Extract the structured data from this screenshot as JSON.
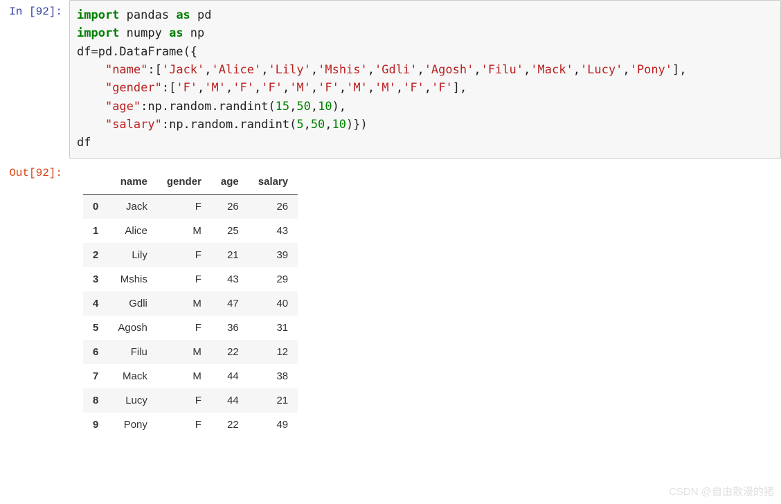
{
  "input_prompt": "In  [92]:",
  "output_prompt": "Out[92]:",
  "code_tokens": [
    {
      "t": "import",
      "c": "gr"
    },
    {
      "t": " pandas ",
      "c": "bl"
    },
    {
      "t": "as",
      "c": "gr"
    },
    {
      "t": " pd\n",
      "c": "bl"
    },
    {
      "t": "import",
      "c": "gr"
    },
    {
      "t": " numpy ",
      "c": "bl"
    },
    {
      "t": "as",
      "c": "gr"
    },
    {
      "t": " np\n",
      "c": "bl"
    },
    {
      "t": "df=pd.DataFrame({\n",
      "c": "bl"
    },
    {
      "t": "    ",
      "c": "bl"
    },
    {
      "t": "\"name\"",
      "c": "str"
    },
    {
      "t": ":[",
      "c": "bl"
    },
    {
      "t": "'Jack'",
      "c": "str"
    },
    {
      "t": ",",
      "c": "bl"
    },
    {
      "t": "'Alice'",
      "c": "str"
    },
    {
      "t": ",",
      "c": "bl"
    },
    {
      "t": "'Lily'",
      "c": "str"
    },
    {
      "t": ",",
      "c": "bl"
    },
    {
      "t": "'Mshis'",
      "c": "str"
    },
    {
      "t": ",",
      "c": "bl"
    },
    {
      "t": "'Gdli'",
      "c": "str"
    },
    {
      "t": ",",
      "c": "bl"
    },
    {
      "t": "'Agosh'",
      "c": "str"
    },
    {
      "t": ",",
      "c": "bl"
    },
    {
      "t": "'Filu'",
      "c": "str"
    },
    {
      "t": ",",
      "c": "bl"
    },
    {
      "t": "'Mack'",
      "c": "str"
    },
    {
      "t": ",",
      "c": "bl"
    },
    {
      "t": "'Lucy'",
      "c": "str"
    },
    {
      "t": ",",
      "c": "bl"
    },
    {
      "t": "'Pony'",
      "c": "str"
    },
    {
      "t": "],\n",
      "c": "bl"
    },
    {
      "t": "    ",
      "c": "bl"
    },
    {
      "t": "\"gender\"",
      "c": "str"
    },
    {
      "t": ":[",
      "c": "bl"
    },
    {
      "t": "'F'",
      "c": "str"
    },
    {
      "t": ",",
      "c": "bl"
    },
    {
      "t": "'M'",
      "c": "str"
    },
    {
      "t": ",",
      "c": "bl"
    },
    {
      "t": "'F'",
      "c": "str"
    },
    {
      "t": ",",
      "c": "bl"
    },
    {
      "t": "'F'",
      "c": "str"
    },
    {
      "t": ",",
      "c": "bl"
    },
    {
      "t": "'M'",
      "c": "str"
    },
    {
      "t": ",",
      "c": "bl"
    },
    {
      "t": "'F'",
      "c": "str"
    },
    {
      "t": ",",
      "c": "bl"
    },
    {
      "t": "'M'",
      "c": "str"
    },
    {
      "t": ",",
      "c": "bl"
    },
    {
      "t": "'M'",
      "c": "str"
    },
    {
      "t": ",",
      "c": "bl"
    },
    {
      "t": "'F'",
      "c": "str"
    },
    {
      "t": ",",
      "c": "bl"
    },
    {
      "t": "'F'",
      "c": "str"
    },
    {
      "t": "],\n",
      "c": "bl"
    },
    {
      "t": "    ",
      "c": "bl"
    },
    {
      "t": "\"age\"",
      "c": "str"
    },
    {
      "t": ":np.random.randint(",
      "c": "bl"
    },
    {
      "t": "15",
      "c": "num"
    },
    {
      "t": ",",
      "c": "bl"
    },
    {
      "t": "50",
      "c": "num"
    },
    {
      "t": ",",
      "c": "bl"
    },
    {
      "t": "10",
      "c": "num"
    },
    {
      "t": "),\n",
      "c": "bl"
    },
    {
      "t": "    ",
      "c": "bl"
    },
    {
      "t": "\"salary\"",
      "c": "str"
    },
    {
      "t": ":np.random.randint(",
      "c": "bl"
    },
    {
      "t": "5",
      "c": "num"
    },
    {
      "t": ",",
      "c": "bl"
    },
    {
      "t": "50",
      "c": "num"
    },
    {
      "t": ",",
      "c": "bl"
    },
    {
      "t": "10",
      "c": "num"
    },
    {
      "t": ")})\n",
      "c": "bl"
    },
    {
      "t": "df",
      "c": "bl"
    }
  ],
  "table": {
    "columns": [
      "name",
      "gender",
      "age",
      "salary"
    ],
    "index": [
      "0",
      "1",
      "2",
      "3",
      "4",
      "5",
      "6",
      "7",
      "8",
      "9"
    ],
    "rows": [
      [
        "Jack",
        "F",
        "26",
        "26"
      ],
      [
        "Alice",
        "M",
        "25",
        "43"
      ],
      [
        "Lily",
        "F",
        "21",
        "39"
      ],
      [
        "Mshis",
        "F",
        "43",
        "29"
      ],
      [
        "Gdli",
        "M",
        "47",
        "40"
      ],
      [
        "Agosh",
        "F",
        "36",
        "31"
      ],
      [
        "Filu",
        "M",
        "22",
        "12"
      ],
      [
        "Mack",
        "M",
        "44",
        "38"
      ],
      [
        "Lucy",
        "F",
        "44",
        "21"
      ],
      [
        "Pony",
        "F",
        "22",
        "49"
      ]
    ]
  },
  "watermark": "CSDN @自由散漫的猪"
}
